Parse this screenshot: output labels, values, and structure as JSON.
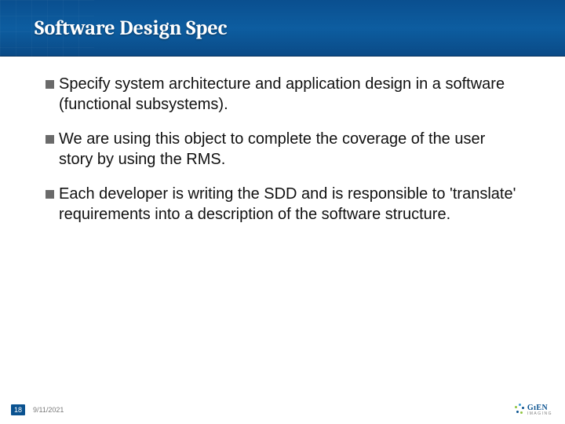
{
  "title": "Software Design Spec",
  "bullets": [
    "Specify system architecture and application design in a software (functional subsystems).",
    "We are using this object to complete the coverage of the user story by using the RMS.",
    "Each developer is writing the SDD and is responsible to 'translate' requirements into a description of the software structure."
  ],
  "footer": {
    "slide_number": "18",
    "date": "9/11/2021"
  },
  "logo": {
    "brand_left": "Gı",
    "brand_right": "EN",
    "sub": "IMAGING"
  }
}
